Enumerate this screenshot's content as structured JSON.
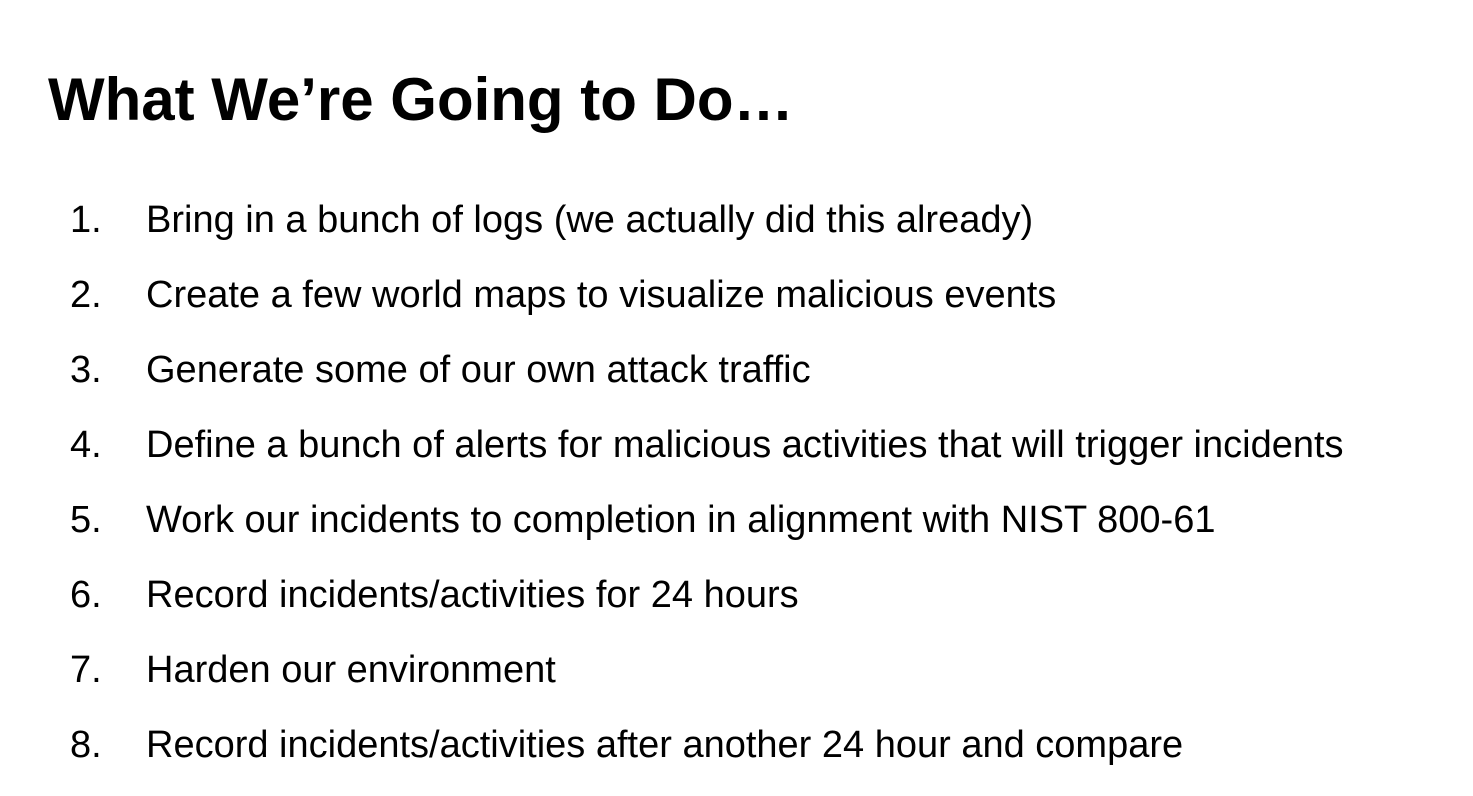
{
  "slide": {
    "title": "What We’re Going to Do…",
    "items": [
      {
        "number": "1.",
        "text": "Bring in a bunch of logs (we actually did this already)"
      },
      {
        "number": "2.",
        "text": "Create a few world maps to visualize malicious events"
      },
      {
        "number": "3.",
        "text": "Generate some of our own attack traffic"
      },
      {
        "number": "4.",
        "text": "Define a bunch of alerts for malicious activities that will trigger incidents"
      },
      {
        "number": "5.",
        "text": "Work our incidents to completion in alignment with NIST 800-61"
      },
      {
        "number": "6.",
        "text": "Record incidents/activities for 24 hours"
      },
      {
        "number": "7.",
        "text": "Harden our environment"
      },
      {
        "number": "8.",
        "text": "Record incidents/activities after another 24 hour and compare"
      }
    ]
  },
  "colors": {
    "background": "#ffffff",
    "text": "#000000"
  }
}
